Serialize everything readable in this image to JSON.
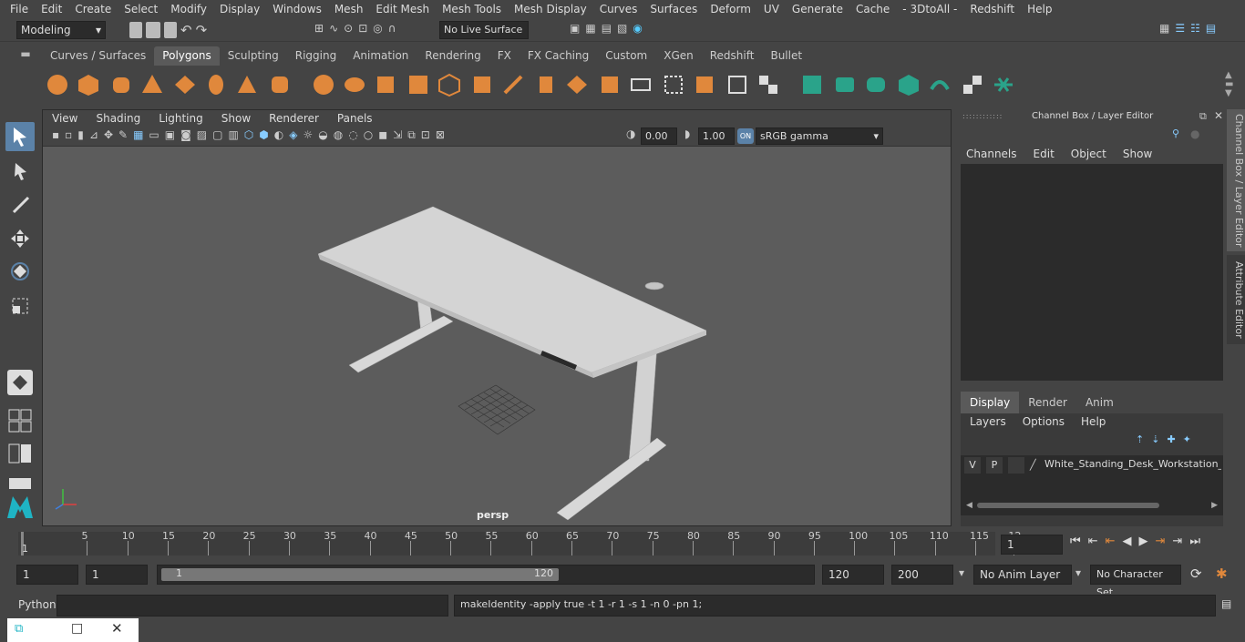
{
  "menubar": [
    "File",
    "Edit",
    "Create",
    "Select",
    "Modify",
    "Display",
    "Windows",
    "Mesh",
    "Edit Mesh",
    "Mesh Tools",
    "Mesh Display",
    "Curves",
    "Surfaces",
    "Deform",
    "UV",
    "Generate",
    "Cache",
    "- 3DtoAll -",
    "Redshift",
    "Help"
  ],
  "status": {
    "mode": "Modeling",
    "live_surface": "No Live Surface"
  },
  "shelf_tabs": [
    "Curves / Surfaces",
    "Polygons",
    "Sculpting",
    "Rigging",
    "Animation",
    "Rendering",
    "FX",
    "FX Caching",
    "Custom",
    "XGen",
    "Redshift",
    "Bullet"
  ],
  "shelf_active": "Polygons",
  "viewport": {
    "menu": [
      "View",
      "Shading",
      "Lighting",
      "Show",
      "Renderer",
      "Panels"
    ],
    "exposure": "0.00",
    "gamma": "1.00",
    "color_space": "sRGB gamma",
    "camera_label": "persp"
  },
  "channelbox": {
    "title": "Channel Box / Layer Editor",
    "menu": [
      "Channels",
      "Edit",
      "Object",
      "Show"
    ],
    "tabs": [
      "Display",
      "Render",
      "Anim"
    ],
    "layer_menu": [
      "Layers",
      "Options",
      "Help"
    ],
    "layer": {
      "v": "V",
      "p": "P",
      "name": "White_Standing_Desk_Workstation_("
    }
  },
  "side_tabs": {
    "channel": "Channel Box / Layer Editor",
    "attr": "Attribute Editor"
  },
  "timeline": {
    "ticks": [
      "5",
      "10",
      "15",
      "20",
      "25",
      "30",
      "35",
      "40",
      "45",
      "50",
      "55",
      "60",
      "65",
      "70",
      "75",
      "80",
      "85",
      "90",
      "95",
      "100",
      "105",
      "110",
      "115",
      "12"
    ],
    "start_label": "1",
    "current_frame": "1"
  },
  "range": {
    "start": "1",
    "start2": "1",
    "slider_start": "1",
    "slider_end": "120",
    "end": "120",
    "end2": "200",
    "anim_layer": "No Anim Layer",
    "char_set": "No Character Set"
  },
  "cmd": {
    "lang": "Python",
    "output": "makeIdentity -apply true -t 1 -r 1 -s 1 -n 0 -pn 1;"
  }
}
